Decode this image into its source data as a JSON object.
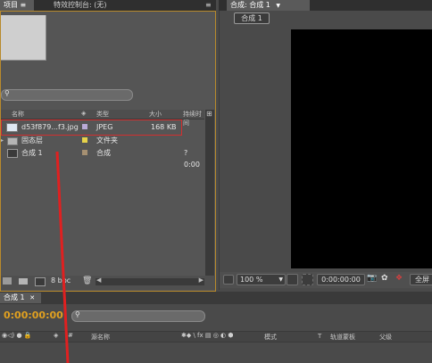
{
  "project_panel": {
    "tab_label": "项目 ≡",
    "effects_tab_label": "特效控制台: (无)",
    "search_placeholder": "",
    "columns": [
      "名称",
      "类型",
      "大小",
      "持续时间"
    ],
    "items": [
      {
        "name": "d53f879...f3.jpg",
        "type": "JPEG",
        "size": "168 KB",
        "duration": "",
        "swatch": "#b9a9d6",
        "icon": "image-icon"
      },
      {
        "name": "固态层",
        "type": "文件夹",
        "size": "",
        "duration": "",
        "swatch": "#e6d24a",
        "icon": "folder-icon"
      },
      {
        "name": "合成 1",
        "type": "合成",
        "size": "",
        "duration": "? 0:00",
        "swatch": "#a69072",
        "icon": "composition-icon"
      }
    ],
    "bpc_label": "8 bpc"
  },
  "composition_viewer": {
    "tab_label": "合成: 合成 1",
    "breadcrumb": "合成 1",
    "zoom": "100 %",
    "timecode": "0:00:00:00",
    "resolution": "全屏"
  },
  "timeline": {
    "tab_label": "合成 1",
    "current_time": "0:00:00:00",
    "columns": [
      "源名称",
      "模式",
      "T",
      "轨道蒙板",
      "父级"
    ]
  },
  "colors": {
    "accent_timecode": "#e0a020",
    "annotation_red": "#e02020"
  }
}
